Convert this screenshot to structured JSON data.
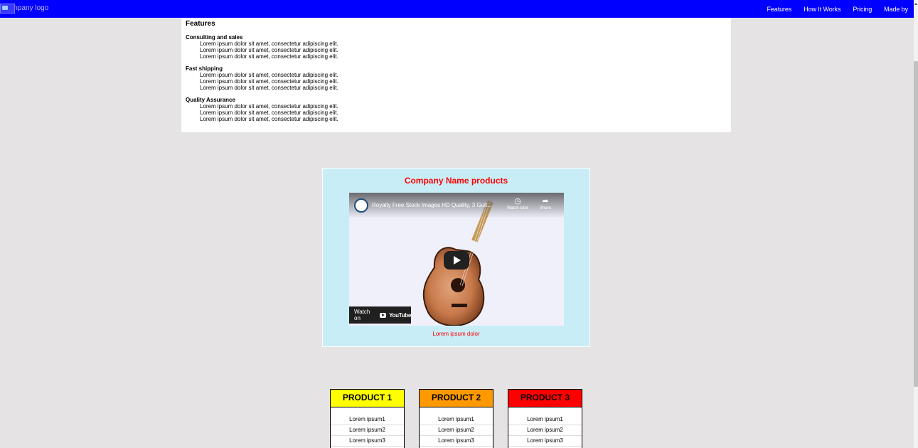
{
  "navbar": {
    "logo_alt": "company logo",
    "links": [
      "Features",
      "How It Works",
      "Pricing",
      "Made by"
    ],
    "background": "#0000ff"
  },
  "features": {
    "heading": "Features",
    "items": [
      {
        "title": "Consulting and sales",
        "lines": [
          "Lorem ipsum dolor sit amet, consectetur adipiscing elit.",
          "Lorem ipsum dolor sit amet, consectetur adipiscing elit.",
          "Lorem ipsum dolor sit amet, consectetur adipiscing elit."
        ]
      },
      {
        "title": "Fast shipping",
        "lines": [
          "Lorem ipsum dolor sit amet, consectetur adipiscing elit.",
          "Lorem ipsum dolor sit amet, consectetur adipiscing elit.",
          "Lorem ipsum dolor sit amet, consectetur adipiscing elit."
        ]
      },
      {
        "title": "Quality Assurance",
        "lines": [
          "Lorem ipsum dolor sit amet, consectetur adipiscing elit.",
          "Lorem ipsum dolor sit amet, consectetur adipiscing elit.",
          "Lorem ipsum dolor sit amet, consectetur adipiscing elit."
        ]
      }
    ]
  },
  "products_section": {
    "title": "Company Name products",
    "caption": "Lorem ipsum dolor",
    "title_color": "#ff0000",
    "background": "#c9edf7",
    "video": {
      "title": "Royalty Free Stock Images HD Quality, 3 Guit...",
      "watch_later": "Watch later",
      "share": "Share",
      "watch_on": "Watch on",
      "youtube": "YouTube",
      "icons": [
        "clock-icon",
        "share-icon",
        "play-icon",
        "youtube-logo-icon"
      ]
    }
  },
  "pricing": {
    "cards": [
      {
        "name": "PRODUCT 1",
        "color": "#ffff00",
        "items": [
          "Lorem ipsum1",
          "Lorem ipsum2",
          "Lorem ipsum3"
        ]
      },
      {
        "name": "PRODUCT 2",
        "color": "#ff9900",
        "items": [
          "Lorem ipsum1",
          "Lorem ipsum2",
          "Lorem ipsum3"
        ]
      },
      {
        "name": "PRODUCT 3",
        "color": "#ff0000",
        "items": [
          "Lorem ipsum1",
          "Lorem ipsum2",
          "Lorem ipsum3"
        ]
      }
    ]
  }
}
